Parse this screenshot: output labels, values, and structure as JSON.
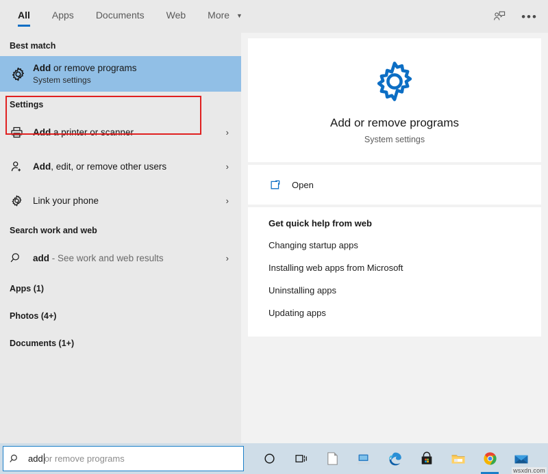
{
  "tabbar": {
    "tabs": [
      {
        "label": "All",
        "active": true
      },
      {
        "label": "Apps",
        "active": false
      },
      {
        "label": "Documents",
        "active": false
      },
      {
        "label": "Web",
        "active": false
      },
      {
        "label": "More",
        "active": false,
        "has_chevron": true
      }
    ],
    "feedback_icon": "feedback-person-icon",
    "more_options_icon": "ellipsis-icon",
    "accent_color": "#0c6ec4"
  },
  "left_panel": {
    "best_match": {
      "header": "Best match",
      "icon": "gear-icon",
      "title_bold": "Add",
      "title_rest": " or remove programs",
      "subtitle": "System settings",
      "highlight_color": "#91bfe6",
      "annotation_color": "#e02020"
    },
    "settings": {
      "header": "Settings",
      "items": [
        {
          "icon": "printer-icon",
          "bold": "Add",
          "rest": " a printer or scanner",
          "chevron": "›"
        },
        {
          "icon": "add-user-icon",
          "bold": "Add",
          "rest": ", edit, or remove other users",
          "chevron": "›"
        },
        {
          "icon": "gear-icon",
          "bold": "",
          "rest": "Link your phone",
          "chevron": "›"
        }
      ]
    },
    "search_work_web": {
      "header": "Search work and web",
      "item": {
        "icon": "search-icon",
        "bold": "add",
        "rest": " - See work and web results",
        "chevron": "›"
      }
    },
    "counts": [
      "Apps (1)",
      "Photos (4+)",
      "Documents (1+)"
    ]
  },
  "right_panel": {
    "hero": {
      "icon": "gear-icon",
      "icon_color": "#0c6ec4",
      "title": "Add or remove programs",
      "subtitle": "System settings"
    },
    "actions": [
      {
        "icon": "open-external-icon",
        "label": "Open"
      }
    ],
    "help": {
      "header": "Get quick help from web",
      "links": [
        "Changing startup apps",
        "Installing web apps from Microsoft",
        "Uninstalling apps",
        "Updating apps"
      ]
    }
  },
  "taskbar": {
    "search": {
      "icon": "search-icon",
      "typed_value": "add",
      "ghost_suggestion": " or remove programs",
      "border_color": "#1a7ec8"
    },
    "tray_items": [
      {
        "name": "cortana-icon"
      },
      {
        "name": "task-view-icon"
      },
      {
        "name": "document-icon"
      },
      {
        "name": "remote-desktop-icon"
      },
      {
        "name": "edge-browser-icon"
      },
      {
        "name": "microsoft-store-icon"
      },
      {
        "name": "file-explorer-icon"
      },
      {
        "name": "chrome-browser-icon"
      },
      {
        "name": "mail-icon"
      }
    ],
    "watermark": "wsxdn.com"
  }
}
